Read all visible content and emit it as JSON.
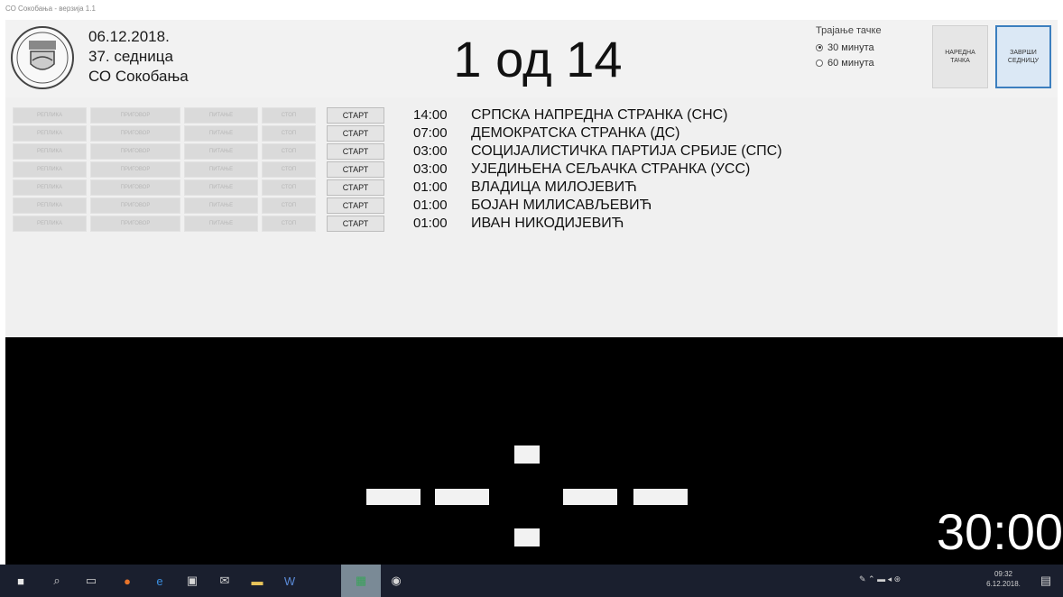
{
  "window": {
    "title": "СО Сокобања - верзија 1.1"
  },
  "session": {
    "date": "06.12.2018.",
    "number": "37. седница",
    "place": "СО Сокобања"
  },
  "counter": "1 од 14",
  "duration": {
    "label": "Трајање тачке",
    "options": [
      {
        "label": "30 минута",
        "selected": true
      },
      {
        "label": "60 минута",
        "selected": false
      }
    ]
  },
  "buttons": {
    "next": "НАРЕДНА ТАЧКА",
    "close": "ЗАВРШИ СЕДНИЦУ"
  },
  "row_controls": {
    "c1": "РЕПЛИКА",
    "c2": "ПРИГОВОР",
    "c3": "ПИТАЊЕ",
    "c4": "СТОП",
    "start": "СТАРТ"
  },
  "speakers": [
    {
      "time": "14:00",
      "name": "СРПСКА НАПРЕДНА СТРАНКА (СНС)"
    },
    {
      "time": "07:00",
      "name": "ДЕМОКРАТСКА СТРАНКА (ДС)"
    },
    {
      "time": "03:00",
      "name": "СОЦИЈАЛИСТИЧКА ПАРТИЈА СРБИЈЕ (СПС)"
    },
    {
      "time": "03:00",
      "name": "УЈЕДИЊЕНА СЕЉАЧКА СТРАНКА (УСС)"
    },
    {
      "time": "01:00",
      "name": "ВЛАДИЦА МИЛОЈЕВИЋ"
    },
    {
      "time": "01:00",
      "name": "БОЈАН МИЛИСАВЉЕВИЋ"
    },
    {
      "time": "01:00",
      "name": "ИВАН НИКОДИЈЕВИЋ"
    }
  ],
  "display": {
    "timer": "30:00"
  },
  "taskbar": {
    "icons": [
      "windows-start-icon",
      "search-icon",
      "task-view-icon",
      "firefox-icon",
      "edge-icon",
      "store-icon",
      "mail-icon",
      "file-explorer-icon",
      "word-icon",
      "app-icon",
      "camera-icon"
    ],
    "clock": "09:32",
    "date": "6.12.2018."
  }
}
